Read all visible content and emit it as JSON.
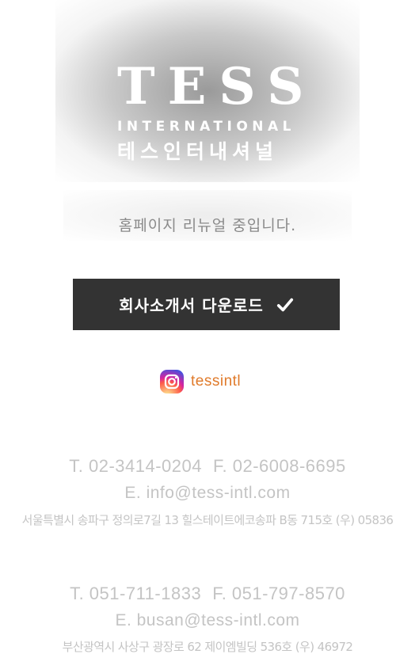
{
  "logo": {
    "main": "TESS",
    "sub": "INTERNATIONAL",
    "korean": "테스인터내셔널"
  },
  "notice": "홈페이지 리뉴얼 중입니다.",
  "download": {
    "label": "회사소개서 다운로드"
  },
  "instagram": {
    "handle": "tessintl",
    "icon": "instagram-icon"
  },
  "seoul": {
    "tel": "T. 02-3414-0204",
    "fax": "F. 02-6008-6695",
    "email": "E. info@tess-intl.com",
    "address": "서울특별시 송파구 정의로7길 13 힐스테이트에코송파 B동 715호 (우) 05836"
  },
  "busan": {
    "tel": "T. 051-711-1833",
    "fax": "F. 051-797-8570",
    "email": "E. busan@tess-intl.com",
    "address": "부산광역시 사상구 광장로 62 제이엠빌딩 536호 (우) 46972"
  },
  "colors": {
    "button_bg": "#333333",
    "contact_text": "#c4c4c4",
    "insta_handle": "#e07a2a"
  }
}
